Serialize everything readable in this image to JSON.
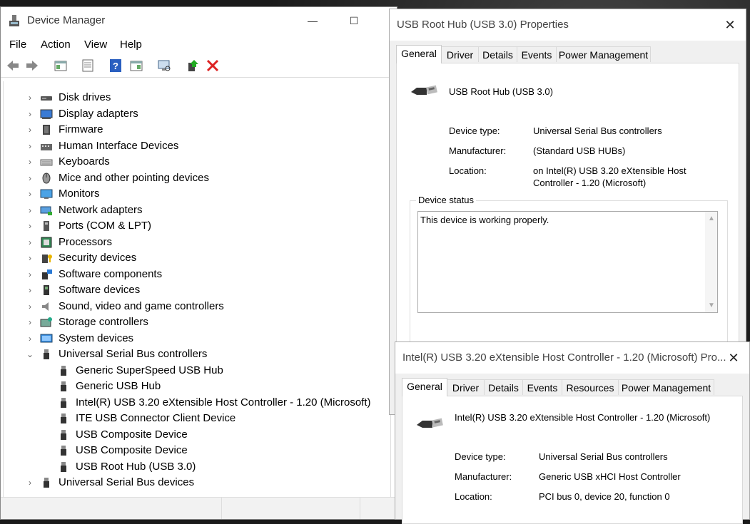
{
  "device_manager": {
    "title": "Device Manager",
    "menu": [
      "File",
      "Action",
      "View",
      "Help"
    ],
    "tree": [
      {
        "label": "Disk drives",
        "icon": "disk-icon",
        "level": 0,
        "expanded": false
      },
      {
        "label": "Display adapters",
        "icon": "display-icon",
        "level": 0,
        "expanded": false
      },
      {
        "label": "Firmware",
        "icon": "chip-icon",
        "level": 0,
        "expanded": false
      },
      {
        "label": "Human Interface Devices",
        "icon": "hid-icon",
        "level": 0,
        "expanded": false
      },
      {
        "label": "Keyboards",
        "icon": "keyboard-icon",
        "level": 0,
        "expanded": false
      },
      {
        "label": "Mice and other pointing devices",
        "icon": "mouse-icon",
        "level": 0,
        "expanded": false
      },
      {
        "label": "Monitors",
        "icon": "monitor-icon",
        "level": 0,
        "expanded": false
      },
      {
        "label": "Network adapters",
        "icon": "network-icon",
        "level": 0,
        "expanded": false
      },
      {
        "label": "Ports (COM & LPT)",
        "icon": "port-icon",
        "level": 0,
        "expanded": false
      },
      {
        "label": "Processors",
        "icon": "processor-icon",
        "level": 0,
        "expanded": false
      },
      {
        "label": "Security devices",
        "icon": "security-icon",
        "level": 0,
        "expanded": false
      },
      {
        "label": "Software components",
        "icon": "software-component-icon",
        "level": 0,
        "expanded": false
      },
      {
        "label": "Software devices",
        "icon": "software-device-icon",
        "level": 0,
        "expanded": false
      },
      {
        "label": "Sound, video and game controllers",
        "icon": "speaker-icon",
        "level": 0,
        "expanded": false
      },
      {
        "label": "Storage controllers",
        "icon": "storage-icon",
        "level": 0,
        "expanded": false
      },
      {
        "label": "System devices",
        "icon": "system-icon",
        "level": 0,
        "expanded": false
      },
      {
        "label": "Universal Serial Bus controllers",
        "icon": "usb-icon",
        "level": 0,
        "expanded": true
      },
      {
        "label": "Generic SuperSpeed USB Hub",
        "icon": "usb-icon",
        "level": 1
      },
      {
        "label": "Generic USB Hub",
        "icon": "usb-icon",
        "level": 1
      },
      {
        "label": "Intel(R) USB 3.20 eXtensible Host Controller - 1.20 (Microsoft)",
        "icon": "usb-icon",
        "level": 1
      },
      {
        "label": "ITE USB Connector Client Device",
        "icon": "usb-icon",
        "level": 1
      },
      {
        "label": "USB Composite Device",
        "icon": "usb-icon",
        "level": 1
      },
      {
        "label": "USB Composite Device",
        "icon": "usb-icon",
        "level": 1
      },
      {
        "label": "USB Root Hub (USB 3.0)",
        "icon": "usb-icon",
        "level": 1
      },
      {
        "label": "Universal Serial Bus devices",
        "icon": "usb-icon",
        "level": 0,
        "expanded": false
      }
    ]
  },
  "dialog1": {
    "title": "USB Root Hub (USB 3.0) Properties",
    "tabs": [
      "General",
      "Driver",
      "Details",
      "Events",
      "Power Management"
    ],
    "device_name": "USB Root Hub (USB 3.0)",
    "device_type_label": "Device type:",
    "device_type": "Universal Serial Bus controllers",
    "manufacturer_label": "Manufacturer:",
    "manufacturer": "(Standard USB HUBs)",
    "location_label": "Location:",
    "location_line1": "on Intel(R) USB 3.20 eXtensible Host",
    "location_line2": "Controller - 1.20 (Microsoft)",
    "status_group": "Device status",
    "status_text": "This device is working properly."
  },
  "dialog2": {
    "title": "Intel(R) USB 3.20 eXtensible Host Controller - 1.20 (Microsoft) Pro...",
    "tabs": [
      "General",
      "Driver",
      "Details",
      "Events",
      "Resources",
      "Power Management"
    ],
    "device_name": "Intel(R) USB 3.20 eXtensible Host Controller - 1.20 (Microsoft)",
    "device_type_label": "Device type:",
    "device_type": "Universal Serial Bus controllers",
    "manufacturer_label": "Manufacturer:",
    "manufacturer": "Generic USB xHCI Host Controller",
    "location_label": "Location:",
    "location": "PCI bus 0, device 20, function 0"
  }
}
